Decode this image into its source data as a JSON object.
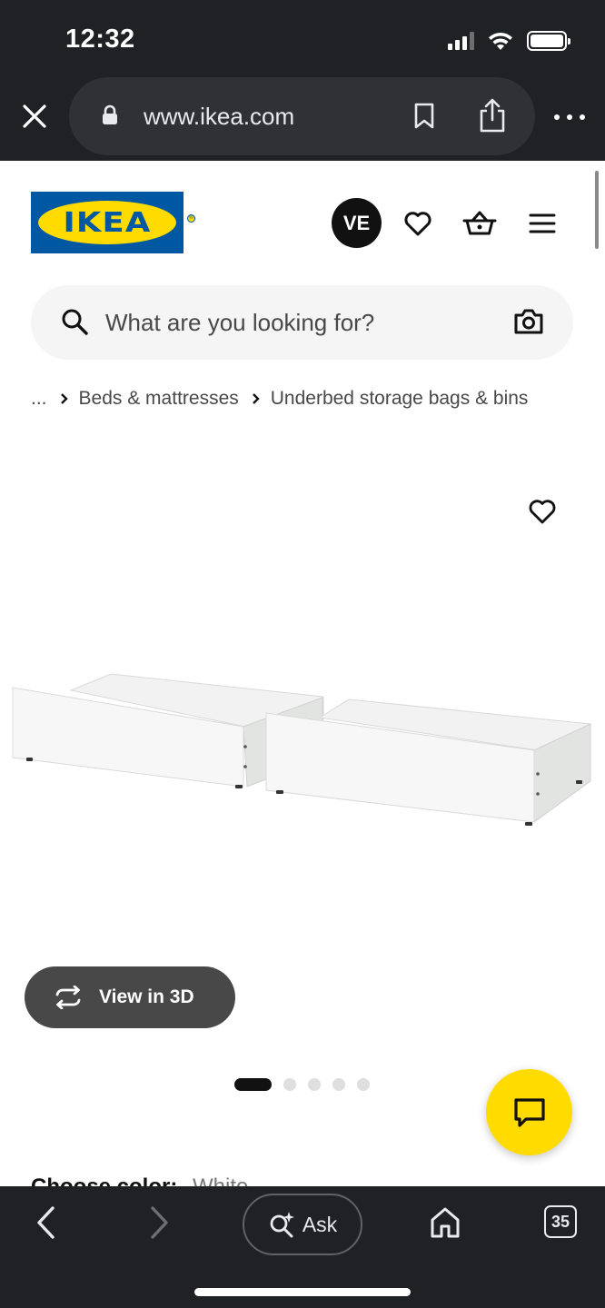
{
  "status_bar": {
    "time": "12:32"
  },
  "browser": {
    "url": "www.ikea.com",
    "tab_count": "35",
    "ask_label": "Ask"
  },
  "header": {
    "logo_text": "IKEA",
    "logo_registered_mark": "®",
    "avatar_initials": "VE",
    "brand_colors": {
      "blue": "#0058a3",
      "yellow": "#ffdb00"
    }
  },
  "search": {
    "placeholder": "What are you looking for?"
  },
  "breadcrumb": {
    "ellipsis": "...",
    "items": [
      "Beds & mattresses",
      "Underbed storage bags & bins"
    ]
  },
  "product": {
    "view_3d_label": "View in 3D",
    "carousel": {
      "total": 5,
      "active": 1
    },
    "choose_color_label": "Choose color:",
    "selected_color": "White"
  },
  "icons": {
    "close": "close-icon",
    "lock": "lock-icon",
    "bookmark": "bookmark-icon",
    "share": "share-icon",
    "more": "more-icon",
    "favorite": "heart-icon",
    "cart": "shopping-basket-icon",
    "menu": "hamburger-menu-icon",
    "search": "search-icon",
    "camera": "camera-icon",
    "rotate": "rotate-3d-icon",
    "chat": "chat-icon",
    "back": "back-arrow-icon",
    "forward": "forward-arrow-icon",
    "home": "home-icon",
    "ai_search": "sparkle-search-icon"
  }
}
